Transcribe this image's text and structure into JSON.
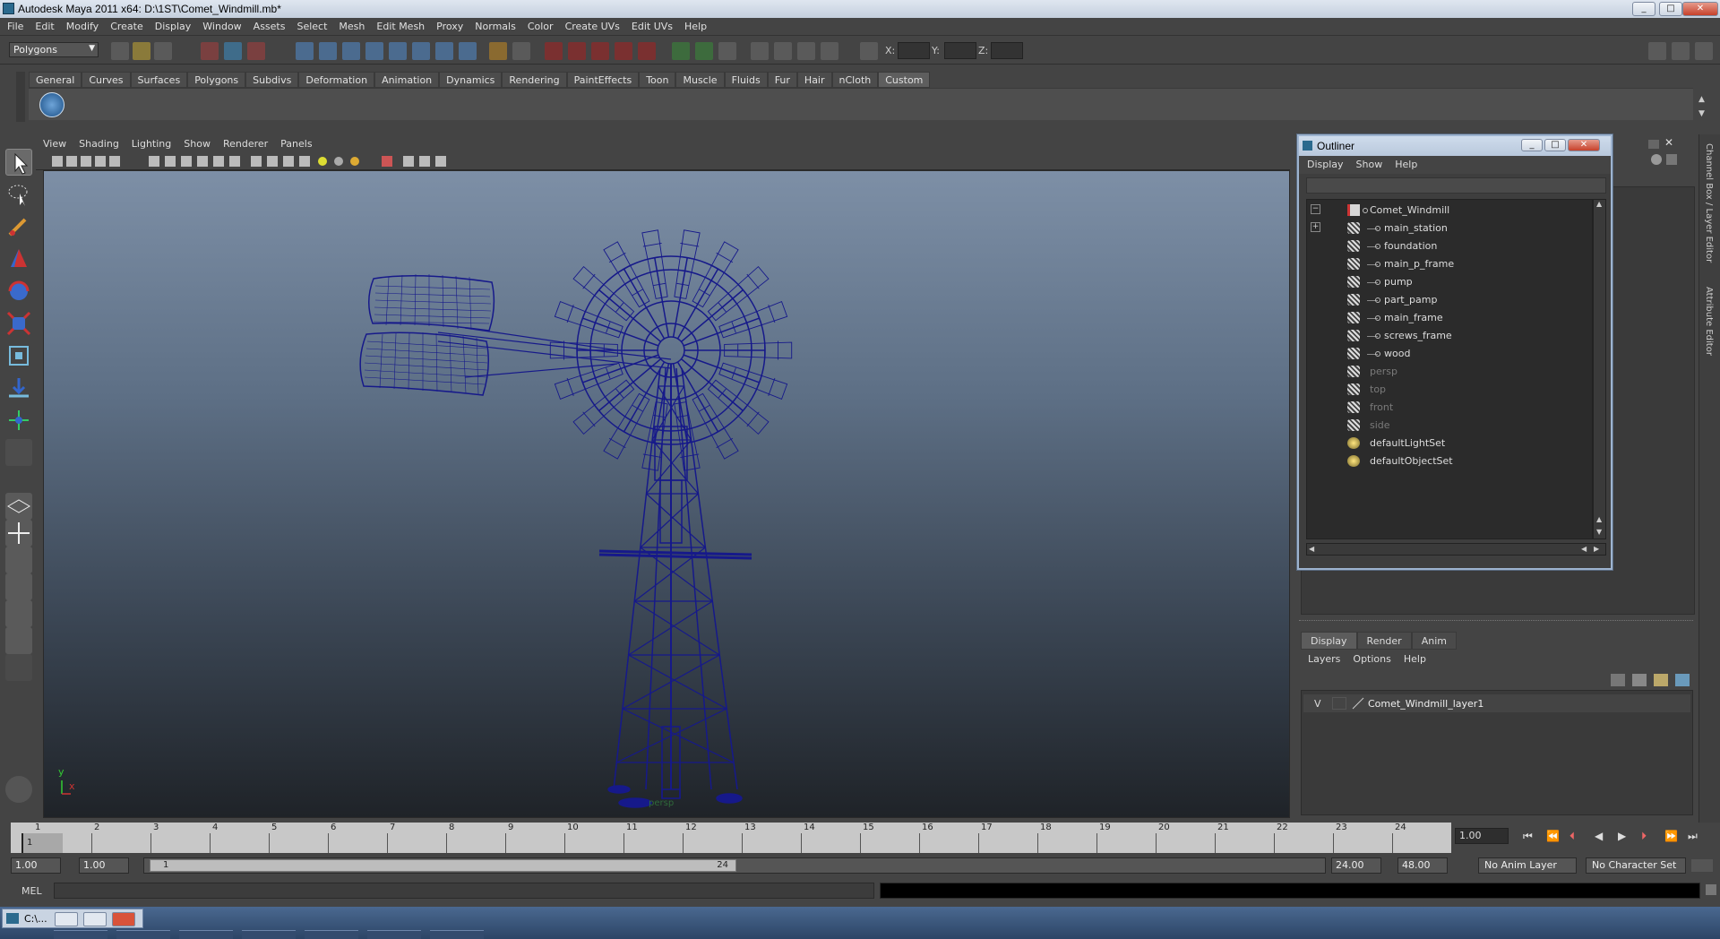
{
  "window": {
    "title": "Autodesk Maya 2011 x64: D:\\1ST\\Comet_Windmill.mb*",
    "buttons": [
      "minimize",
      "maximize",
      "close"
    ]
  },
  "menubar": [
    "File",
    "Edit",
    "Modify",
    "Create",
    "Display",
    "Window",
    "Assets",
    "Select",
    "Mesh",
    "Edit Mesh",
    "Proxy",
    "Normals",
    "Color",
    "Create UVs",
    "Edit UVs",
    "Help"
  ],
  "statusline": {
    "menu_set": "Polygons",
    "coord_x_label": "X:",
    "coord_y_label": "Y:",
    "coord_z_label": "Z:"
  },
  "shelf": {
    "tabs": [
      "General",
      "Curves",
      "Surfaces",
      "Polygons",
      "Subdivs",
      "Deformation",
      "Animation",
      "Dynamics",
      "Rendering",
      "PaintEffects",
      "Toon",
      "Muscle",
      "Fluids",
      "Fur",
      "Hair",
      "nCloth",
      "Custom"
    ],
    "active_tab": "Custom"
  },
  "viewport": {
    "menu": [
      "View",
      "Shading",
      "Lighting",
      "Show",
      "Renderer",
      "Panels"
    ],
    "camera_label": "persp",
    "axis_y": "y",
    "axis_x": "x"
  },
  "outliner": {
    "title": "Outliner",
    "menu": [
      "Display",
      "Show",
      "Help"
    ],
    "items": [
      {
        "label": "Comet_Windmill",
        "depth": 0,
        "expander": "−",
        "icon": "group-icon",
        "dim": false
      },
      {
        "label": "main_station",
        "depth": 1,
        "expander": "+",
        "icon": "mesh-icon",
        "dim": false
      },
      {
        "label": "foundation",
        "depth": 1,
        "expander": "",
        "icon": "mesh-icon",
        "dim": false
      },
      {
        "label": "main_p_frame",
        "depth": 1,
        "expander": "",
        "icon": "mesh-icon",
        "dim": false
      },
      {
        "label": "pump",
        "depth": 1,
        "expander": "",
        "icon": "mesh-icon",
        "dim": false
      },
      {
        "label": "part_pamp",
        "depth": 1,
        "expander": "",
        "icon": "mesh-icon",
        "dim": false
      },
      {
        "label": "main_frame",
        "depth": 1,
        "expander": "",
        "icon": "mesh-icon",
        "dim": false
      },
      {
        "label": "screws_frame",
        "depth": 1,
        "expander": "",
        "icon": "mesh-icon",
        "dim": false
      },
      {
        "label": "wood",
        "depth": 1,
        "expander": "",
        "icon": "mesh-icon",
        "dim": false
      },
      {
        "label": "persp",
        "depth": 0,
        "expander": "",
        "icon": "camera-icon",
        "dim": true
      },
      {
        "label": "top",
        "depth": 0,
        "expander": "",
        "icon": "camera-icon",
        "dim": true
      },
      {
        "label": "front",
        "depth": 0,
        "expander": "",
        "icon": "camera-icon",
        "dim": true
      },
      {
        "label": "side",
        "depth": 0,
        "expander": "",
        "icon": "camera-icon",
        "dim": true
      },
      {
        "label": "defaultLightSet",
        "depth": 0,
        "expander": "",
        "icon": "set-icon",
        "dim": false
      },
      {
        "label": "defaultObjectSet",
        "depth": 0,
        "expander": "",
        "icon": "set-icon",
        "dim": false
      }
    ]
  },
  "side_tabs": [
    "Channel Box / Layer Editor",
    "Attribute Editor"
  ],
  "layer_editor": {
    "tabs": [
      "Display",
      "Render",
      "Anim"
    ],
    "active_tab": "Display",
    "menu": [
      "Layers",
      "Options",
      "Help"
    ],
    "layers": [
      {
        "visible": "V",
        "name": "Comet_Windmill_layer1"
      }
    ]
  },
  "time_slider": {
    "ticks": [
      "1",
      "2",
      "3",
      "4",
      "5",
      "6",
      "7",
      "8",
      "9",
      "10",
      "11",
      "12",
      "13",
      "14",
      "15",
      "16",
      "17",
      "18",
      "19",
      "20",
      "21",
      "22",
      "23",
      "24"
    ],
    "current_marker": "1",
    "current_frame": "1.00"
  },
  "range_slider": {
    "start_time": "1.00",
    "playback_start": "1.00",
    "range_start_label": "1",
    "range_end_label": "24",
    "playback_end": "24.00",
    "end_time": "48.00",
    "anim_layer": "No Anim Layer",
    "character_set": "No Character Set"
  },
  "command_line": {
    "label": "MEL"
  },
  "taskbar": {
    "item_label": "C:\\..."
  },
  "colors": {
    "wireframe": "#16198a",
    "viewport_top": "#7d8fa6",
    "viewport_bottom": "#1f2328",
    "ui_bg": "#444444"
  }
}
